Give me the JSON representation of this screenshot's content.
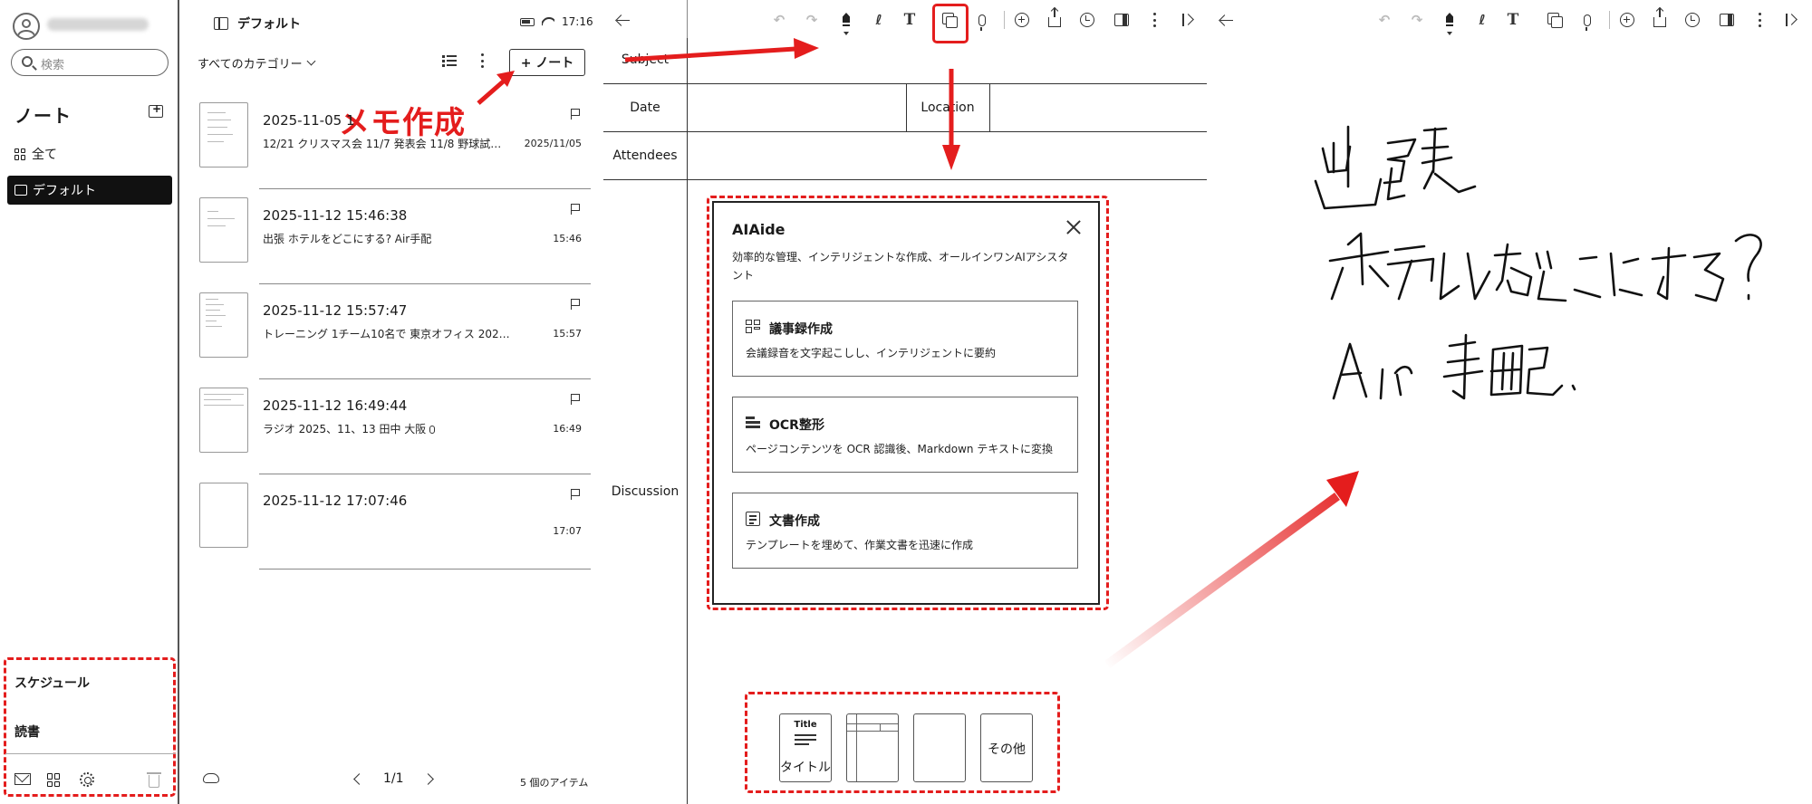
{
  "sidebar": {
    "search_placeholder": "検索",
    "section_title": "ノート",
    "items": [
      {
        "label": "全て"
      },
      {
        "label": "デフォルト",
        "active": true
      }
    ],
    "bottom_items": [
      {
        "label": "スケジュール"
      },
      {
        "label": "読書"
      }
    ]
  },
  "note_list": {
    "folder_title": "デフォルト",
    "clock": "17:16",
    "category_filter": "すべてのカテゴリー",
    "new_note_label": "+ ノート",
    "annotation": "メモ作成",
    "notes": [
      {
        "title": "2025-11-05 1",
        "snippet": "12/21 クリスマス会 11/7 発表会 11/8 野球試…",
        "date": "2025/11/05"
      },
      {
        "title": "2025-11-12 15:46:38",
        "snippet": "出張 ホテルをどこにする? Air手配",
        "date": "15:46"
      },
      {
        "title": "2025-11-12 15:57:47",
        "snippet": "トレーニング 1チーム10名で 東京オフィス 2025/1…",
        "date": "15:57"
      },
      {
        "title": "2025-11-12 16:49:44",
        "snippet": "ラジオ 2025、11、13 田中 大阪",
        "date": "16:49",
        "has_audio": true
      },
      {
        "title": "2025-11-12 17:07:46",
        "snippet": "",
        "date": "17:07"
      }
    ],
    "pager": "1/1",
    "item_count": "5 個のアイテム"
  },
  "meeting_template": {
    "subject": "Subject",
    "date": "Date",
    "location": "Location",
    "attendees": "Attendees",
    "discussion": "Discussion"
  },
  "ai_aide": {
    "title": "AIAide",
    "description": "効率的な管理、インテリジェントな作成、オールインワンAIアシスタント",
    "cards": [
      {
        "title": "議事録作成",
        "desc": "会議録音を文字起こしし、インテリジェントに要約"
      },
      {
        "title": "OCR整形",
        "desc": "ページコンテンツを OCR 認識後、Markdown テキストに変換"
      },
      {
        "title": "文書作成",
        "desc": "テンプレートを埋めて、作業文書を迅速に作成"
      }
    ]
  },
  "template_picker": {
    "title_card_small": "Title",
    "title_card_caption": "タイトル",
    "other_label": "その他"
  },
  "colors": {
    "annotation_red": "#e41d1d",
    "active_item_bg": "#111111"
  }
}
